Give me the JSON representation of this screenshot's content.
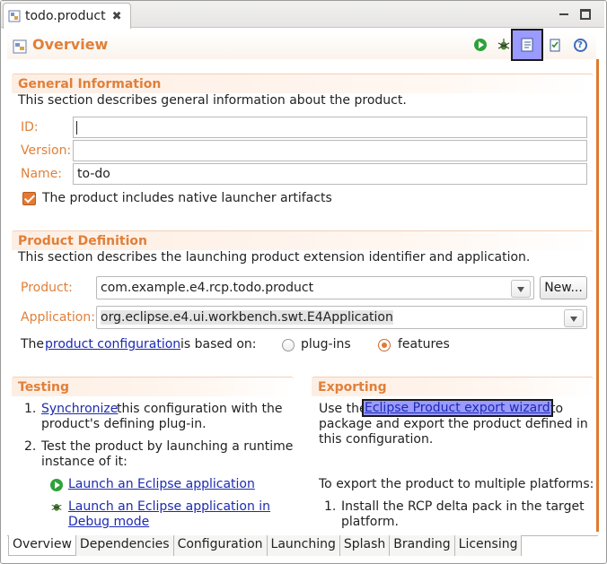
{
  "editor_tab": {
    "title": "todo.product",
    "close_glyph": "✖"
  },
  "header": {
    "title": "Overview",
    "toolbar_icons": [
      "run-icon",
      "debug-icon",
      "outline-icon",
      "validate-icon",
      "help-icon"
    ],
    "help_glyph": "?"
  },
  "general": {
    "title": "General Information",
    "description": "This section describes general information about the product.",
    "id_label": "ID:",
    "id_value": "",
    "version_label": "Version:",
    "version_value": "",
    "name_label": "Name:",
    "name_value": "to-do",
    "launcher_checkbox_label": "The product includes native launcher artifacts",
    "launcher_checked": true
  },
  "definition": {
    "title": "Product Definition",
    "description": "This section describes the launching product extension identifier and application.",
    "product_label": "Product:",
    "product_value": "com.example.e4.rcp.todo.product",
    "new_button": "New...",
    "application_label": "Application:",
    "application_value": "org.eclipse.e4.ui.workbench.swt.E4Application",
    "config_prefix": "The",
    "config_link": "product configuration",
    "config_suffix": "is based on:",
    "option_plugins": "plug-ins",
    "option_features": "features",
    "selected_option": "features"
  },
  "testing": {
    "title": "Testing",
    "item1_num": "1.",
    "item1_link": "Synchronize",
    "item1_rest_line1": "this configuration with the",
    "item1_rest_line2": "product's defining plug-in.",
    "item2_num": "2.",
    "item2_line1": "Test the product by launching a runtime",
    "item2_line2": "instance of it:",
    "launch_link": "Launch an Eclipse application",
    "debug_link_line1": "Launch an Eclipse application in",
    "debug_link_line2": "Debug mode"
  },
  "exporting": {
    "title": "Exporting",
    "use_the": "Use the",
    "export_link": "Eclipse Product export wizard",
    "to": "to",
    "line2": "package and export the product defined in",
    "line3": "this configuration.",
    "multi_platform": "To export the product to multiple platforms:",
    "item1_num": "1.",
    "item1_line1": "Install the RCP delta pack in the target",
    "item1_line2": "platform."
  },
  "bottom_tabs": [
    "Overview",
    "Dependencies",
    "Configuration",
    "Launching",
    "Splash",
    "Branding",
    "Licensing"
  ],
  "active_bottom_tab": "Overview",
  "colors": {
    "accent": "#e0803a",
    "link": "#1d2ab0",
    "highlight": "#9a9aff"
  }
}
